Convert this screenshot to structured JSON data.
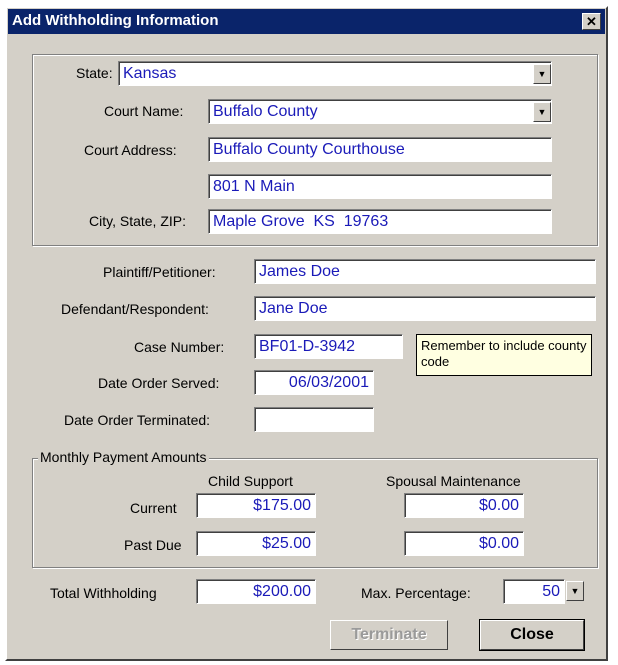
{
  "window": {
    "title": "Add Withholding Information",
    "close_glyph": "✕"
  },
  "court_group": {
    "state_label": "State:",
    "state_value": "Kansas",
    "court_name_label": "Court Name:",
    "court_name_value": "Buffalo County",
    "court_address_label": "Court Address:",
    "court_address_line1": "Buffalo County Courthouse",
    "court_address_line2": "801 N Main",
    "city_state_zip_label": "City, State, ZIP:",
    "city_state_zip_value": "Maple Grove  KS  19763"
  },
  "case": {
    "plaintiff_label": "Plaintiff/Petitioner:",
    "plaintiff_value": "James Doe",
    "defendant_label": "Defendant/Respondent:",
    "defendant_value": "Jane Doe",
    "case_number_label": "Case Number:",
    "case_number_value": "BF01-D-3942",
    "date_served_label": "Date Order Served:",
    "date_served_value": "06/03/2001",
    "date_terminated_label": "Date Order Terminated:",
    "date_terminated_value": "",
    "tooltip": "Remember to include county code"
  },
  "payments": {
    "group_label": "Monthly Payment Amounts",
    "child_support_header": "Child Support",
    "spousal_header": "Spousal Maintenance",
    "current_label": "Current",
    "past_due_label": "Past Due",
    "child_current": "$175.00",
    "child_past_due": "$25.00",
    "spousal_current": "$0.00",
    "spousal_past_due": "$0.00"
  },
  "totals": {
    "total_label": "Total Withholding",
    "total_value": "$200.00",
    "max_pct_label": "Max. Percentage:",
    "max_pct_value": "50"
  },
  "buttons": {
    "terminate": "Terminate",
    "close": "Close"
  },
  "icons": {
    "dropdown": "chevron-down-icon",
    "spinner": "spinner-icon",
    "close": "close-icon"
  }
}
